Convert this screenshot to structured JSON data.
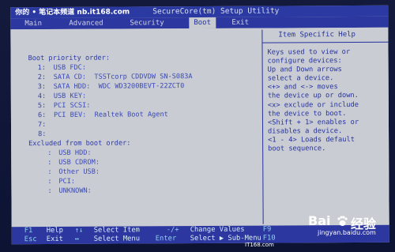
{
  "watermark_top": "你的 • 笔记本频道  nb.it168.com",
  "window_title": "SecureCore(tm) Setup Utility",
  "tabs": [
    {
      "label": "Main"
    },
    {
      "label": "Advanced"
    },
    {
      "label": "Security"
    },
    {
      "label": "Boot",
      "active": true
    },
    {
      "label": "Exit"
    }
  ],
  "boot": {
    "priority_title": "Boot priority order:",
    "priority": [
      {
        "num": "1:",
        "label": "USB FDC:"
      },
      {
        "num": "2:",
        "label": "SATA CD:  TSSTcorp CDDVDW SN-S083A"
      },
      {
        "num": "3:",
        "label": "SATA HDD:  WDC WD3200BEVT-22ZCT0"
      },
      {
        "num": "4:",
        "label": "USB KEY:"
      },
      {
        "num": "5:",
        "label": "PCI SCSI:"
      },
      {
        "num": "6:",
        "label": "PCI BEV:  Realtek Boot Agent"
      },
      {
        "num": "7:",
        "label": ""
      },
      {
        "num": "8:",
        "label": ""
      }
    ],
    "excluded_title": "Excluded from boot order:",
    "excluded": [
      {
        "num": ":",
        "label": "USB HDD:"
      },
      {
        "num": ":",
        "label": "USB CDROM:"
      },
      {
        "num": ":",
        "label": "Other USB:"
      },
      {
        "num": ":",
        "label": "PCI:"
      },
      {
        "num": ":",
        "label": "UNKNOWN:"
      }
    ]
  },
  "help": {
    "title": "Item Specific Help",
    "text": "Keys used to view or\nconfigure devices:\nUp and Down arrows\nselect a device.\n<+> and <-> moves\nthe device up or down.\n<x> exclude or include\nthe device to boot.\n<Shift + 1> enables or\ndisables a device.\n<1 - 4> Loads default\nboot sequence."
  },
  "footer": {
    "row1": [
      {
        "key": "F1",
        "desc": "Help"
      },
      {
        "key": "↑↓",
        "desc": "Select Item"
      },
      {
        "key": "-/+",
        "desc": "Change Values"
      },
      {
        "key": "F9",
        "desc": ""
      }
    ],
    "row2": [
      {
        "key": "Esc",
        "desc": "Exit"
      },
      {
        "key": "↔",
        "desc": "Select Menu"
      },
      {
        "key": "Enter",
        "desc": "Select ▶ Sub-Menu"
      },
      {
        "key": "F10",
        "desc": ""
      }
    ]
  },
  "baidu": {
    "brand_left": "Bai",
    "brand_right": "经验",
    "site": "jingyan.baidu.com"
  },
  "watermark_bottom": "IT168.com"
}
